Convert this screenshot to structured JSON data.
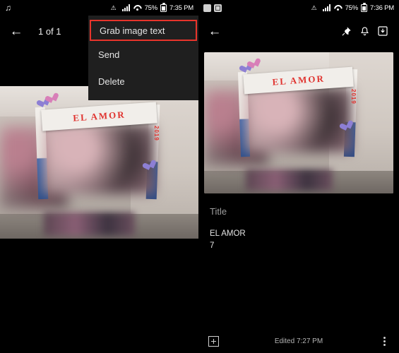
{
  "left_screen": {
    "statusbar": {
      "music_icon": "music-note-icon",
      "cast_icon": "screen-cast-icon",
      "no_sim_icon": "no-sim-icon",
      "signal_icon": "signal-bars-icon",
      "wifi_icon": "wifi-icon",
      "battery_percent": "75%",
      "battery_icon": "battery-icon",
      "time": "7:35 PM"
    },
    "appbar": {
      "back_icon": "arrow-back-icon",
      "title": "1 of 1"
    },
    "menu": {
      "items": [
        {
          "label": "Grab image text",
          "highlighted": true
        },
        {
          "label": "Send",
          "highlighted": false
        },
        {
          "label": "Delete",
          "highlighted": false
        }
      ],
      "highlight_color": "#e8342b"
    },
    "photo": {
      "banner_text": "EL  AMOR",
      "year_text": "2019",
      "alt": "blurred photo of a photo-booth frame in a hallway"
    }
  },
  "right_screen": {
    "statusbar": {
      "cast_icon": "screen-cast-icon",
      "note_icon": "note-app-icon",
      "no_sim_icon": "no-sim-icon",
      "signal_icon": "signal-bars-icon",
      "wifi_icon": "wifi-icon",
      "battery_percent": "75%",
      "battery_icon": "battery-icon",
      "time": "7:36 PM"
    },
    "appbar": {
      "back_icon": "arrow-back-icon",
      "pin_icon": "pin-icon",
      "reminder_icon": "bell-icon",
      "archive_icon": "archive-download-icon"
    },
    "photo": {
      "banner_text": "EL  AMOR",
      "year_text": "2019",
      "alt": "blurred photo of a photo-booth frame in a hallway"
    },
    "note": {
      "title_placeholder": "Title",
      "body_line1": "EL AMOR",
      "body_line2": "7"
    },
    "bottombar": {
      "add_icon": "add-box-icon",
      "edited_text": "Edited 7:27 PM",
      "more_icon": "more-vertical-icon"
    }
  }
}
